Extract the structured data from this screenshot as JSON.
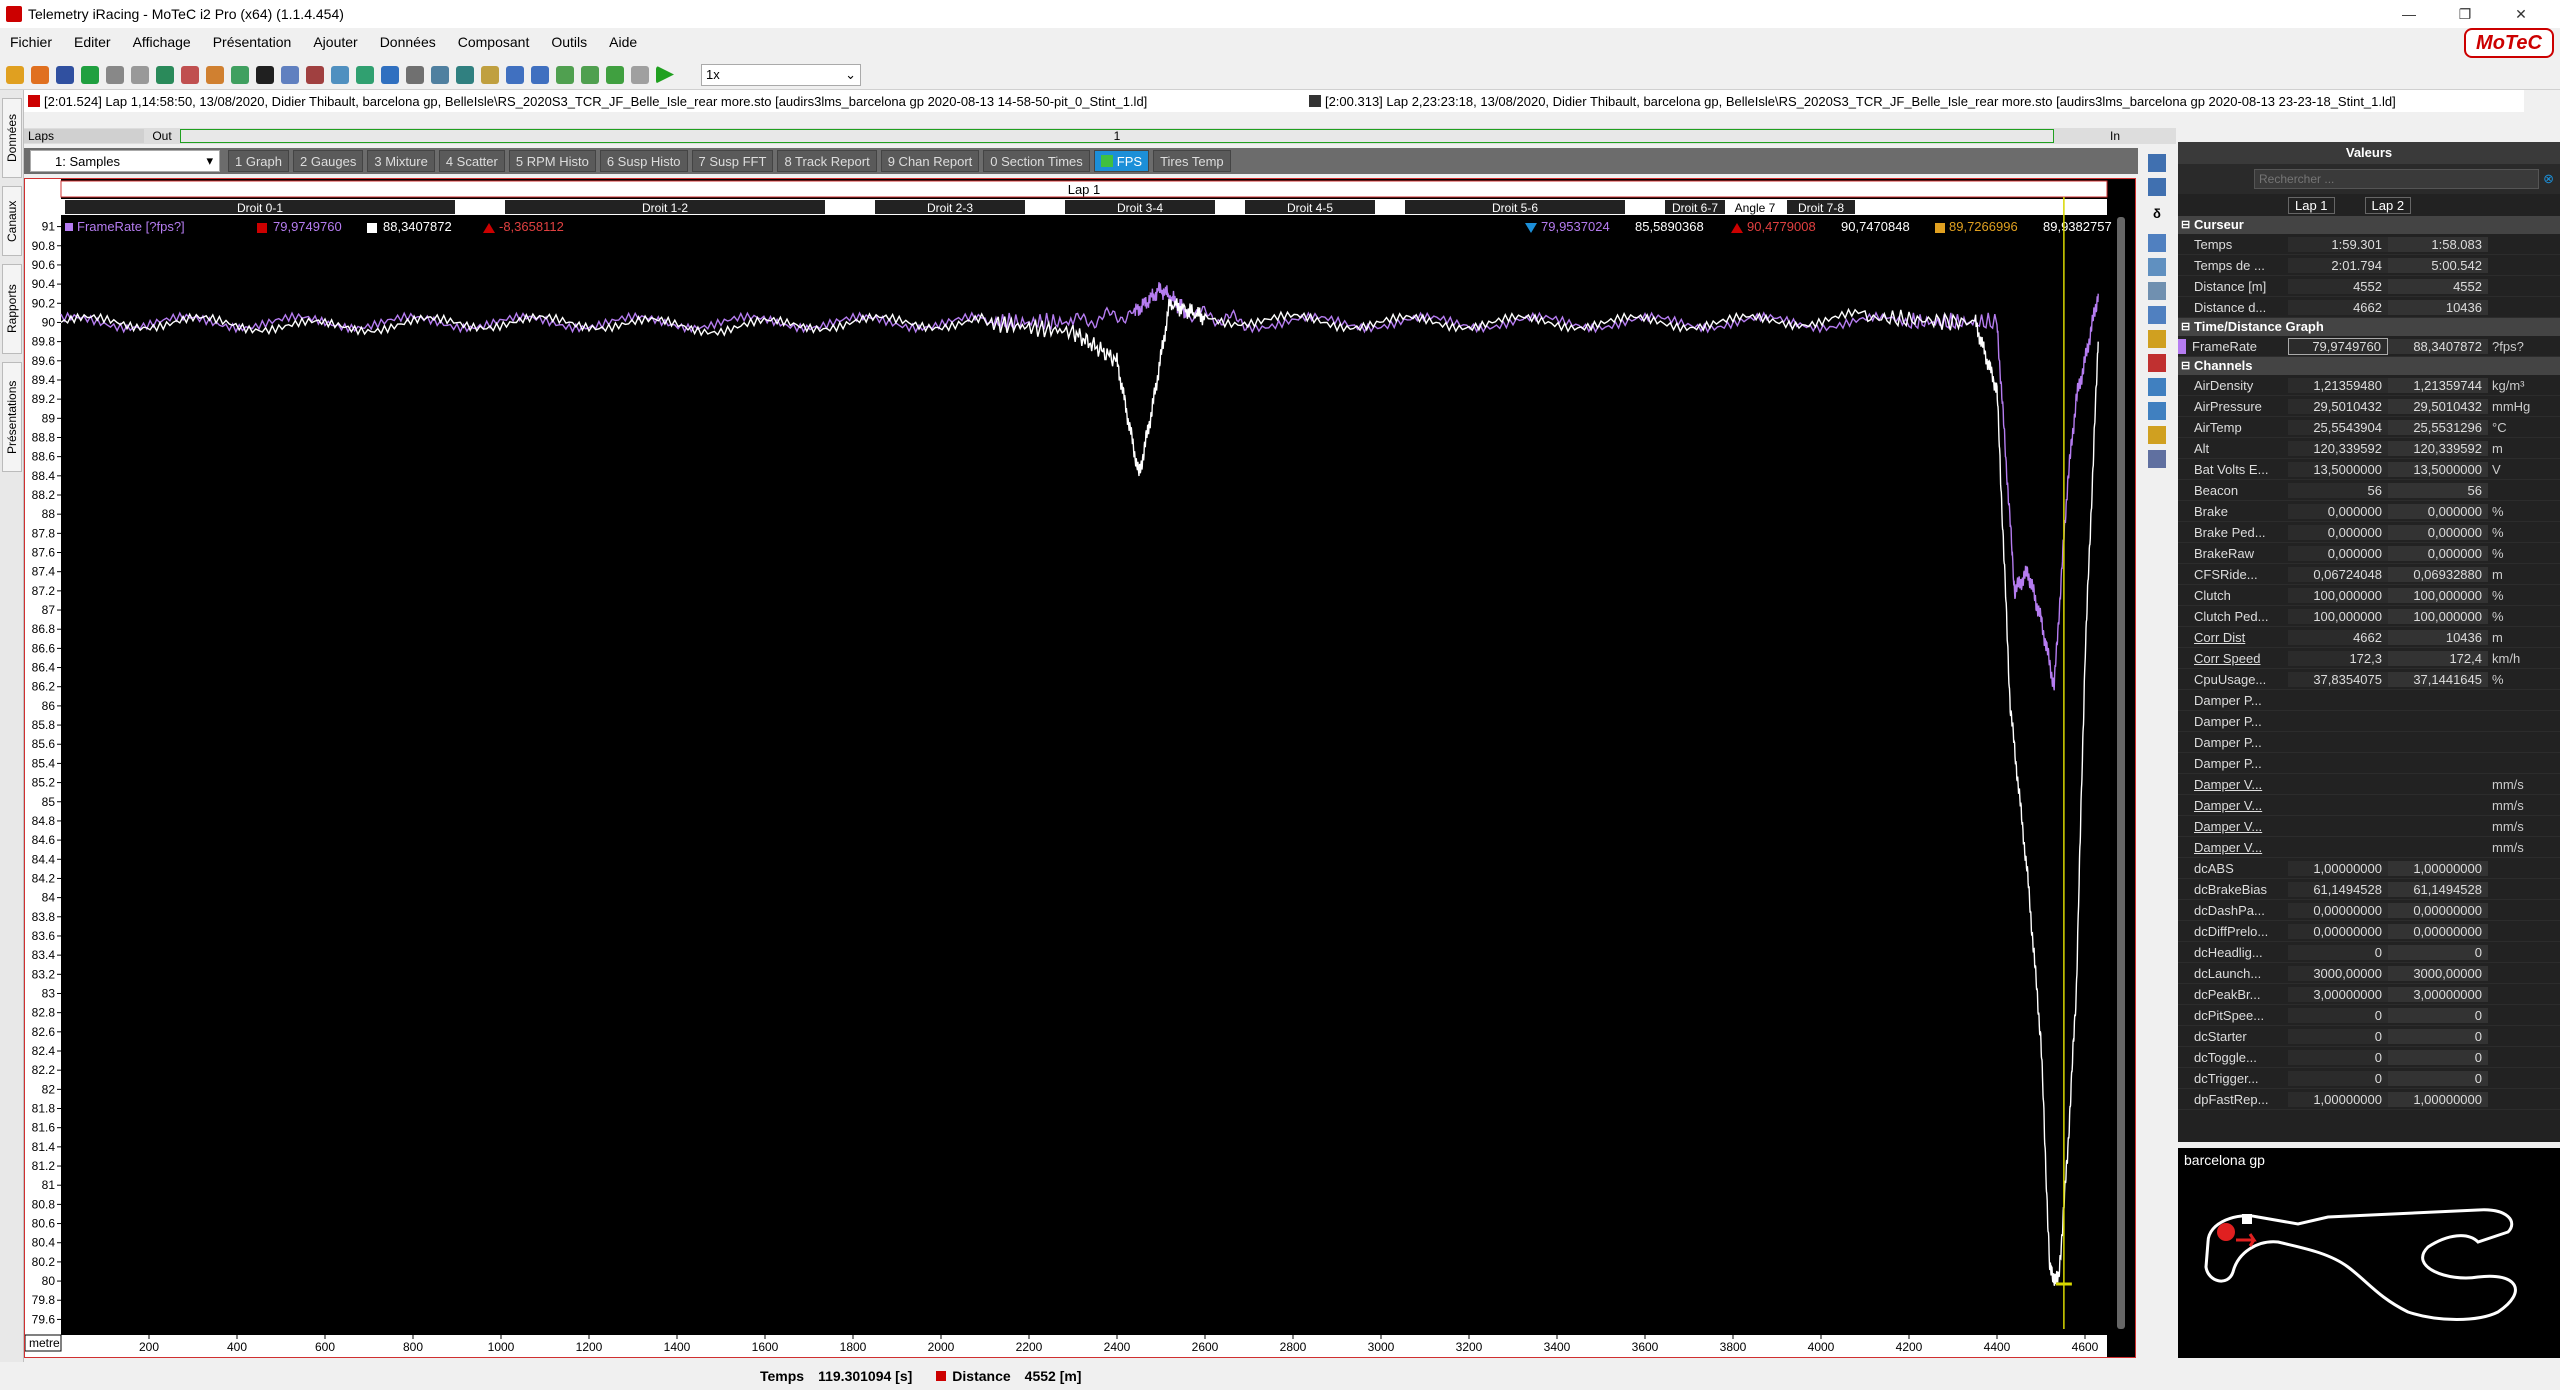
{
  "window": {
    "title": "Telemetry iRacing - MoTeC i2 Pro (x64) (1.1.4.454)",
    "logo": "MoTeC"
  },
  "menu": [
    "Fichier",
    "Editer",
    "Affichage",
    "Présentation",
    "Ajouter",
    "Données",
    "Composant",
    "Outils",
    "Aide"
  ],
  "toolbar": {
    "speed": "1x"
  },
  "lefttabs": [
    "Données",
    "Canaux",
    "Rapports",
    "Présentations"
  ],
  "laps": {
    "ref": "[2:01.524] Lap 1,14:58:50, 13/08/2020, Didier Thibault, barcelona gp, BelleIsle\\RS_2020S3_TCR_JF_Belle_Isle_rear more.sto [audirs3lms_barcelona gp 2020-08-13 14-58-50-pit_0_Stint_1.ld]",
    "cmp": "[2:00.313] Lap 2,23:23:18, 13/08/2020, Didier Thibault, barcelona gp, BelleIsle\\RS_2020S3_TCR_JF_Belle_Isle_rear more.sto [audirs3lms_barcelona gp 2020-08-13 23-23-18_Stint_1.ld]",
    "bar_left": "Laps",
    "bar_out": "Out",
    "bar_1": "1",
    "bar_in": "In"
  },
  "tabs": {
    "samples": "1: Samples",
    "items": [
      "1 Graph",
      "2 Gauges",
      "3 Mixture",
      "4 Scatter",
      "5 RPM Histo",
      "6 Susp Histo",
      "7 Susp FFT",
      "8 Track Report",
      "9 Chan Report",
      "0 Section Times",
      "FPS",
      "Tires Temp"
    ]
  },
  "graph": {
    "lap_label": "Lap 1",
    "sections": [
      "Droit 0-1",
      "Droit 1-2",
      "Droit 2-3",
      "Droit 3-4",
      "Droit 4-5",
      "Droit 5-6",
      "Droit 6-7",
      "Angle 7",
      "Droit 7-8"
    ],
    "legend_channel": "FrameRate [?fps?]",
    "legend_v1": "79,9749760",
    "legend_v2": "88,3407872",
    "legend_delta": "-8,3658112",
    "stat_min1": "79,9537024",
    "stat_min2": "85,5890368",
    "stat_max1": "90,4779008",
    "stat_max2": "90,7470848",
    "stat_avg1": "89,7266996",
    "stat_avg2": "89,9382757",
    "unit_label": "metre",
    "colors": {
      "lap1": "#b57cf0",
      "lap2": "#ffffff",
      "cursor": "#d8d800",
      "border": "#d03030"
    }
  },
  "chart_data": {
    "type": "line",
    "xlabel": "metre",
    "ylabel": "FrameRate [?fps?]",
    "xlim": [
      0,
      4650
    ],
    "ylim": [
      79.5,
      91.1
    ],
    "x_ticks": [
      200,
      400,
      600,
      800,
      1000,
      1200,
      1400,
      1600,
      1800,
      2000,
      2200,
      2400,
      2600,
      2800,
      3000,
      3200,
      3400,
      3600,
      3800,
      4000,
      4200,
      4400,
      4600
    ],
    "y_ticks": [
      91.0,
      90.8,
      90.6,
      90.4,
      90.2,
      90.0,
      89.8,
      89.6,
      89.4,
      89.2,
      89.0,
      88.8,
      88.6,
      88.4,
      88.2,
      88.0,
      87.8,
      87.6,
      87.4,
      87.2,
      87.0,
      86.8,
      86.6,
      86.4,
      86.2,
      86.0,
      85.8,
      85.6,
      85.4,
      85.2,
      85.0,
      84.8,
      84.6,
      84.4,
      84.2,
      84.0,
      83.8,
      83.6,
      83.4,
      83.2,
      83.0,
      82.8,
      82.6,
      82.4,
      82.2,
      82.0,
      81.8,
      81.6,
      81.4,
      81.2,
      81.0,
      80.8,
      80.6,
      80.4,
      80.2,
      80.0,
      79.8,
      79.6
    ],
    "series": [
      {
        "name": "Lap 1",
        "x": [
          0,
          300,
          600,
          900,
          1200,
          1500,
          1800,
          2100,
          2300,
          2400,
          2450,
          2480,
          2520,
          2600,
          2900,
          3200,
          3500,
          3800,
          4100,
          4350,
          4400,
          4430,
          4470,
          4500,
          4520,
          4540,
          4560,
          4580,
          4600,
          4630
        ],
        "y": [
          90.0,
          90.0,
          89.95,
          90.0,
          90.0,
          89.95,
          90.0,
          90.0,
          89.9,
          89.6,
          88.4,
          89.1,
          90.2,
          90.05,
          90.0,
          90.0,
          90.0,
          90.0,
          90.05,
          90.0,
          89.3,
          86.0,
          84.2,
          82.5,
          80.1,
          80.0,
          81.3,
          83.0,
          86.5,
          89.8
        ]
      },
      {
        "name": "Lap 2",
        "x": [
          0,
          300,
          600,
          900,
          1200,
          1500,
          1800,
          2100,
          2300,
          2440,
          2500,
          2560,
          2700,
          3000,
          3300,
          3600,
          3900,
          4200,
          4400,
          4440,
          4470,
          4500,
          4530,
          4560,
          4580,
          4600,
          4630
        ],
        "y": [
          90.0,
          90.0,
          90.0,
          90.0,
          90.0,
          90.0,
          90.0,
          90.0,
          90.0,
          90.1,
          90.35,
          90.1,
          90.0,
          90.0,
          90.0,
          90.0,
          90.0,
          90.0,
          90.0,
          87.2,
          87.4,
          86.9,
          86.2,
          88.3,
          89.2,
          89.6,
          90.3
        ]
      }
    ],
    "cursor_x": 4552
  },
  "panel": {
    "title": "Valeurs",
    "search_placeholder": "Rechercher ...",
    "lap1": "Lap 1",
    "lap2": "Lap 2",
    "sections": {
      "curseur": "Curseur",
      "tdg": "Time/Distance Graph",
      "channels": "Channels"
    },
    "curseur_rows": [
      {
        "n": "Temps",
        "v1": "1:59.301",
        "v2": "1:58.083",
        "u": ""
      },
      {
        "n": "Temps de ...",
        "v1": "2:01.794",
        "v2": "5:00.542",
        "u": ""
      },
      {
        "n": "Distance [m]",
        "v1": "4552",
        "v2": "4552",
        "u": ""
      },
      {
        "n": "Distance d...",
        "v1": "4662",
        "v2": "10436",
        "u": ""
      }
    ],
    "tdg_row": {
      "n": "FrameRate",
      "v1": "79,9749760",
      "v2": "88,3407872",
      "u": "?fps?"
    },
    "channel_rows": [
      {
        "n": "AirDensity",
        "v1": "1,21359480",
        "v2": "1,21359744",
        "u": "kg/m³"
      },
      {
        "n": "AirPressure",
        "v1": "29,5010432",
        "v2": "29,5010432",
        "u": "mmHg"
      },
      {
        "n": "AirTemp",
        "v1": "25,5543904",
        "v2": "25,5531296",
        "u": "°C"
      },
      {
        "n": "Alt",
        "v1": "120,339592",
        "v2": "120,339592",
        "u": "m"
      },
      {
        "n": "Bat Volts E...",
        "v1": "13,5000000",
        "v2": "13,5000000",
        "u": "V"
      },
      {
        "n": "Beacon",
        "v1": "56",
        "v2": "56",
        "u": ""
      },
      {
        "n": "Brake",
        "v1": "0,000000",
        "v2": "0,000000",
        "u": "%"
      },
      {
        "n": "Brake Ped...",
        "v1": "0,000000",
        "v2": "0,000000",
        "u": "%"
      },
      {
        "n": "BrakeRaw",
        "v1": "0,000000",
        "v2": "0,000000",
        "u": "%"
      },
      {
        "n": "CFSRide...",
        "v1": "0,06724048",
        "v2": "0,06932880",
        "u": "m"
      },
      {
        "n": "Clutch",
        "v1": "100,000000",
        "v2": "100,000000",
        "u": "%"
      },
      {
        "n": "Clutch Ped...",
        "v1": "100,000000",
        "v2": "100,000000",
        "u": "%"
      },
      {
        "n": "Corr Dist",
        "v1": "4662",
        "v2": "10436",
        "u": "m"
      },
      {
        "n": "Corr Speed",
        "v1": "172,3",
        "v2": "172,4",
        "u": "km/h"
      },
      {
        "n": "CpuUsage...",
        "v1": "37,8354075",
        "v2": "37,1441645",
        "u": "%"
      },
      {
        "n": "Damper P...",
        "v1": "",
        "v2": "",
        "u": ""
      },
      {
        "n": "Damper P...",
        "v1": "",
        "v2": "",
        "u": ""
      },
      {
        "n": "Damper P...",
        "v1": "",
        "v2": "",
        "u": ""
      },
      {
        "n": "Damper P...",
        "v1": "",
        "v2": "",
        "u": ""
      },
      {
        "n": "Damper V...",
        "v1": "",
        "v2": "",
        "u": "mm/s"
      },
      {
        "n": "Damper V...",
        "v1": "",
        "v2": "",
        "u": "mm/s"
      },
      {
        "n": "Damper V...",
        "v1": "",
        "v2": "",
        "u": "mm/s"
      },
      {
        "n": "Damper V...",
        "v1": "",
        "v2": "",
        "u": "mm/s"
      },
      {
        "n": "dcABS",
        "v1": "1,00000000",
        "v2": "1,00000000",
        "u": ""
      },
      {
        "n": "dcBrakeBias",
        "v1": "61,1494528",
        "v2": "61,1494528",
        "u": ""
      },
      {
        "n": "dcDashPa...",
        "v1": "0,00000000",
        "v2": "0,00000000",
        "u": ""
      },
      {
        "n": "dcDiffPrelo...",
        "v1": "0,00000000",
        "v2": "0,00000000",
        "u": ""
      },
      {
        "n": "dcHeadlig...",
        "v1": "0",
        "v2": "0",
        "u": ""
      },
      {
        "n": "dcLaunch...",
        "v1": "3000,00000",
        "v2": "3000,00000",
        "u": ""
      },
      {
        "n": "dcPeakBr...",
        "v1": "3,00000000",
        "v2": "3,00000000",
        "u": ""
      },
      {
        "n": "dcPitSpee...",
        "v1": "0",
        "v2": "0",
        "u": ""
      },
      {
        "n": "dcStarter",
        "v1": "0",
        "v2": "0",
        "u": ""
      },
      {
        "n": "dcToggle...",
        "v1": "0",
        "v2": "0",
        "u": ""
      },
      {
        "n": "dcTrigger...",
        "v1": "0",
        "v2": "0",
        "u": ""
      },
      {
        "n": "dpFastRep...",
        "v1": "1,00000000",
        "v2": "1,00000000",
        "u": ""
      }
    ]
  },
  "trackmap": {
    "title": "barcelona gp"
  },
  "status": {
    "time_label": "Temps",
    "time_value": "119.301094 [s]",
    "dist_label": "Distance",
    "dist_value": "4552 [m]"
  }
}
